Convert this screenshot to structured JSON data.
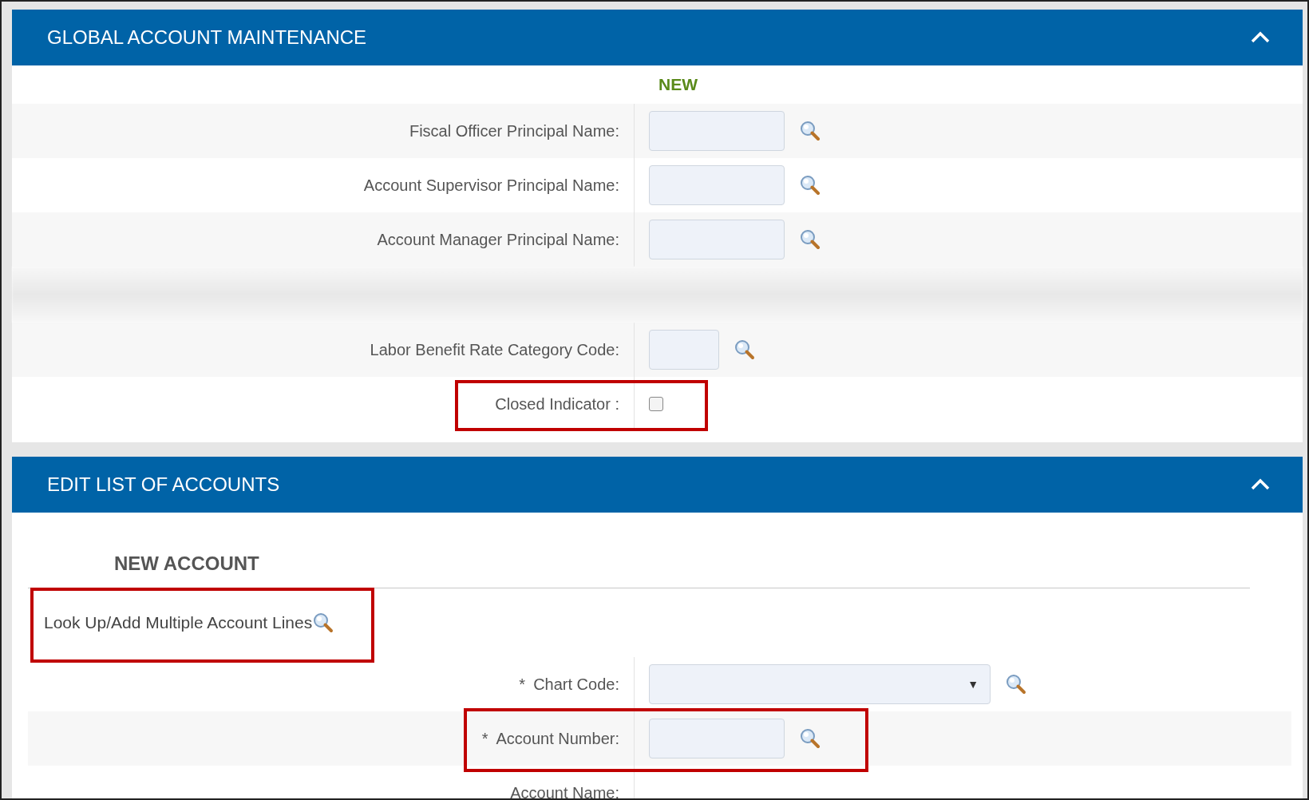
{
  "panels": [
    {
      "title": "GLOBAL ACCOUNT MAINTENANCE",
      "expanded": true,
      "column_heading": "NEW",
      "rows": [
        {
          "kind": "input",
          "label": "Fiscal Officer Principal Name:",
          "highlighted": false
        },
        {
          "kind": "input",
          "label": "Account Supervisor Principal Name:",
          "highlighted": false
        },
        {
          "kind": "input",
          "label": "Account Manager Principal Name:",
          "highlighted": false
        },
        {
          "kind": "faded"
        },
        {
          "kind": "short-input",
          "label": "Labor Benefit Rate Category Code:",
          "highlighted": false
        },
        {
          "kind": "checkbox",
          "label": "Closed Indicator :",
          "checked": false,
          "highlighted": true
        }
      ]
    },
    {
      "title": "EDIT LIST OF ACCOUNTS",
      "expanded": true,
      "section_title": "NEW ACCOUNT",
      "link": {
        "label": "Look Up/Add Multiple Account Lines",
        "highlighted": true
      },
      "rows": [
        {
          "kind": "select",
          "required_mark": "*",
          "label": "Chart Code:",
          "caret": "▼",
          "highlighted": false
        },
        {
          "kind": "input",
          "required_mark": "*",
          "label": "Account Number:",
          "highlighted": true
        },
        {
          "kind": "text",
          "label": "Account Name:",
          "highlighted": false
        }
      ]
    }
  ]
}
